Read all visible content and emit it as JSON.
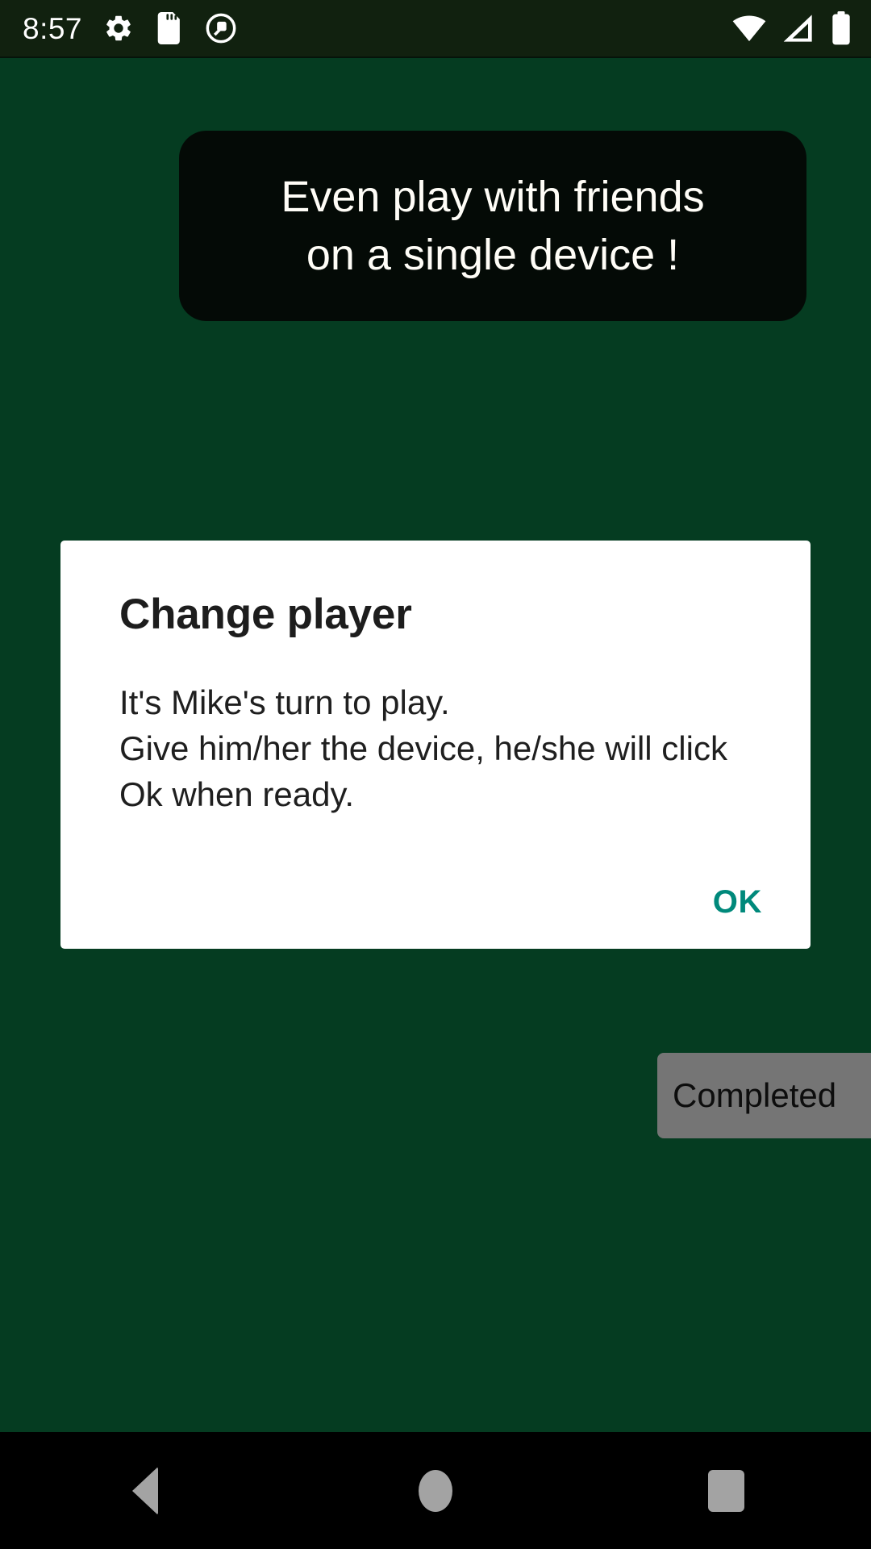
{
  "status_bar": {
    "clock": "8:57",
    "left_icons": [
      {
        "name": "settings-gear-icon"
      },
      {
        "name": "sd-card-icon"
      },
      {
        "name": "android-q-circle-icon"
      }
    ],
    "right_icons": [
      {
        "name": "wifi-icon"
      },
      {
        "name": "cellular-signal-icon"
      },
      {
        "name": "battery-full-icon"
      }
    ],
    "background_color": "#11210F"
  },
  "toast": {
    "message": "Even play with friends\non a single device !",
    "background_color": "#040A06",
    "text_color": "#FFFDF7"
  },
  "dialog": {
    "title": "Change player",
    "message": "It's Mike's turn to play.\nGive him/her the device, he/she will click Ok when ready.",
    "ok_label": "OK",
    "accent_color": "#00897B",
    "background_color": "#FFFFFF"
  },
  "completed_button": {
    "label": "Completed",
    "background_color": "#757575",
    "text_color": "#0D0D0D"
  },
  "nav_bar": {
    "back_label": "Back",
    "home_label": "Home",
    "recents_label": "Recents",
    "background_color": "#000000",
    "icon_color": "#A3A3A3"
  },
  "screen": {
    "background_color": "#053C21"
  }
}
